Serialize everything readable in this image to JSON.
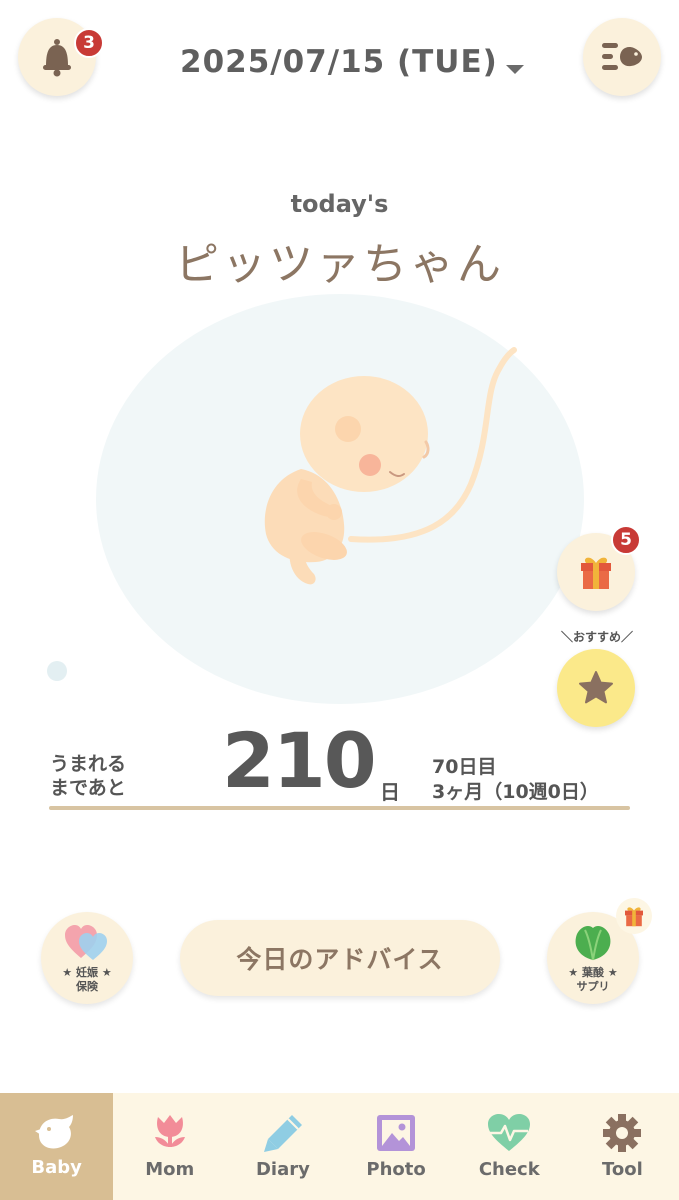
{
  "header": {
    "notification_count": "3",
    "date": "2025/07/15 (TUE)"
  },
  "hero": {
    "todays_label": "today's",
    "baby_name": "ピッツァちゃん"
  },
  "side": {
    "gift_count": "5",
    "osusume_label": "＼おすすめ／"
  },
  "countdown": {
    "remain_label_line1": "うまれる",
    "remain_label_line2": "まであと",
    "days_left": "210",
    "days_unit": "日",
    "pregnancy_days": "70日目",
    "pregnancy_weeks": "3ヶ月（10週0日）"
  },
  "features": {
    "insurance_line1": "★ 妊娠 ★",
    "insurance_line2": "保険",
    "advice_button": "今日のアドバイス",
    "supplement_line1": "★ 葉酸 ★",
    "supplement_line2": "サプリ"
  },
  "tabs": [
    {
      "label": "Baby",
      "icon": "bird-icon",
      "active": true
    },
    {
      "label": "Mom",
      "icon": "tulip-icon",
      "active": false
    },
    {
      "label": "Diary",
      "icon": "pencil-icon",
      "active": false
    },
    {
      "label": "Photo",
      "icon": "photo-icon",
      "active": false
    },
    {
      "label": "Check",
      "icon": "heart-pulse-icon",
      "active": false
    },
    {
      "label": "Tool",
      "icon": "gear-icon",
      "active": false
    }
  ],
  "colors": {
    "accent": "#d8be93",
    "badge": "#c83a36",
    "button_bg": "#fbf1dc",
    "tabbar_bg": "#fdf6e4"
  }
}
